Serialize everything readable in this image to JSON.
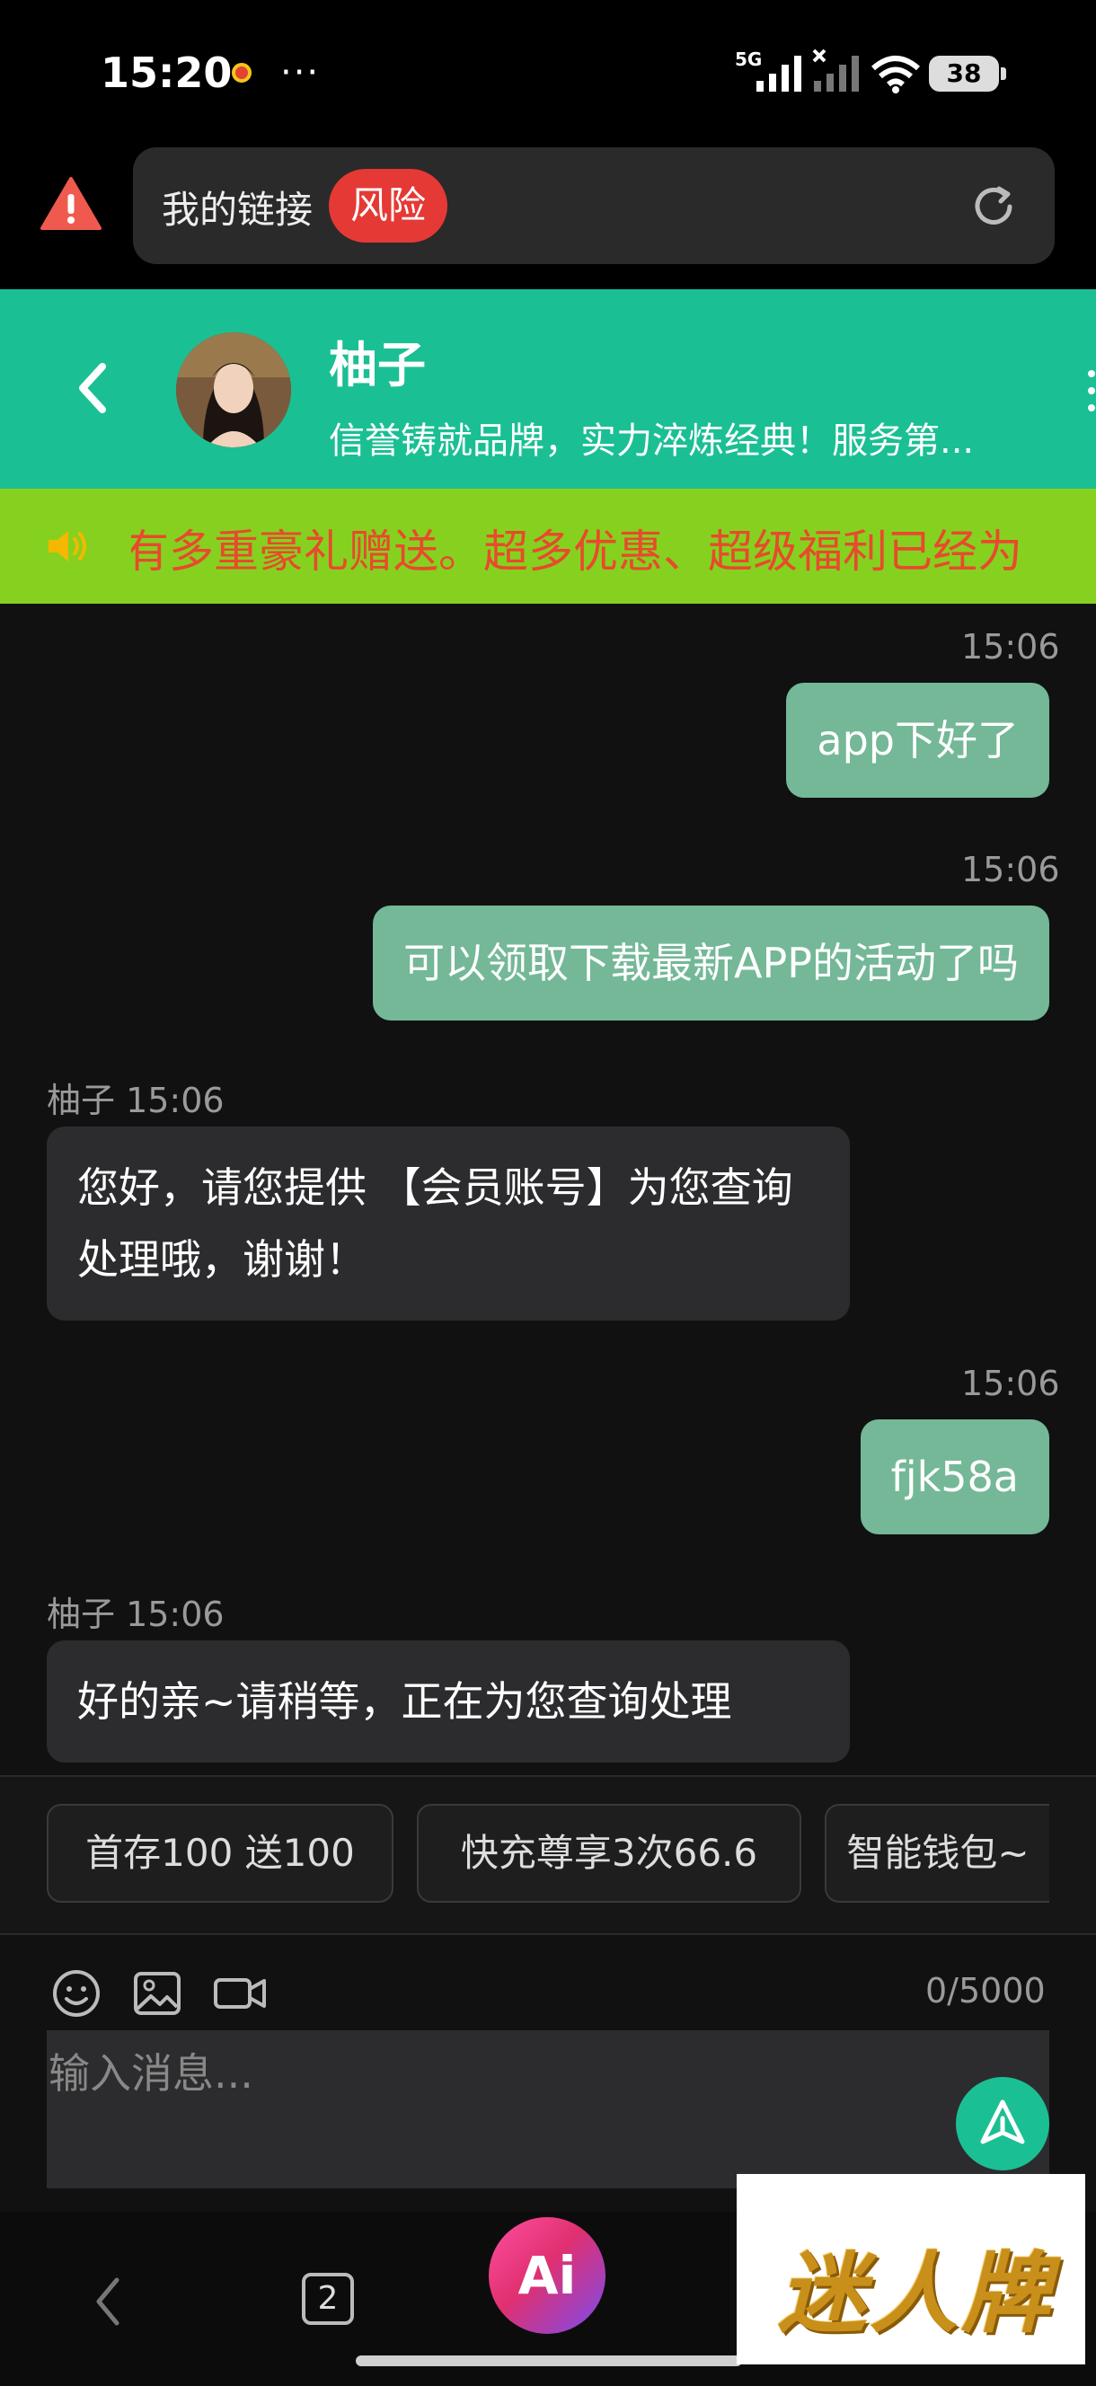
{
  "status_bar": {
    "time": "15:20",
    "overflow": "···",
    "network": "5G",
    "battery": "38"
  },
  "browser": {
    "url_text": "我的链接",
    "risk_badge": "风险",
    "icons": [
      "warning-icon",
      "refresh-icon"
    ]
  },
  "chat_header": {
    "name": "柚子",
    "subtitle": "信誉铸就品牌，实力淬炼经典！服务第...",
    "icons": [
      "back-icon",
      "avatar",
      "more-icon"
    ]
  },
  "marquee": {
    "text": "有多重豪礼赠送。超多优惠、超级福利已经为"
  },
  "messages": [
    {
      "direction": "out",
      "time": "15:06",
      "text": "app下好了"
    },
    {
      "direction": "out",
      "time": "15:06",
      "text": "可以领取下载最新APP的活动了吗"
    },
    {
      "direction": "in",
      "sender_time": "柚子 15:06",
      "text": "您好，请您提供 【会员账号】为您查询处理哦，谢谢！"
    },
    {
      "direction": "out",
      "time": "15:06",
      "text": "fjk58a"
    },
    {
      "direction": "in",
      "sender_time": "柚子 15:06",
      "text": "好的亲~请稍等，正在为您查询处理"
    }
  ],
  "quick_replies": [
    "首存100 送100",
    "快充尊享3次66.6",
    "智能钱包~"
  ],
  "input": {
    "char_count": "0/5000",
    "placeholder": "输入消息...",
    "value": "",
    "tools": [
      "emoji-icon",
      "image-icon",
      "video-icon"
    ]
  },
  "nav": {
    "tabs_count": "2",
    "ai_label": "Ai"
  },
  "watermark": {
    "text": "迷人牌"
  },
  "colors": {
    "header_green": "#1bbf94",
    "marquee_green": "#86d11f",
    "marquee_text": "#e84a2d",
    "outgoing_bubble": "#74b897",
    "incoming_bubble": "#2c2c2e",
    "risk_red": "#e53935"
  }
}
